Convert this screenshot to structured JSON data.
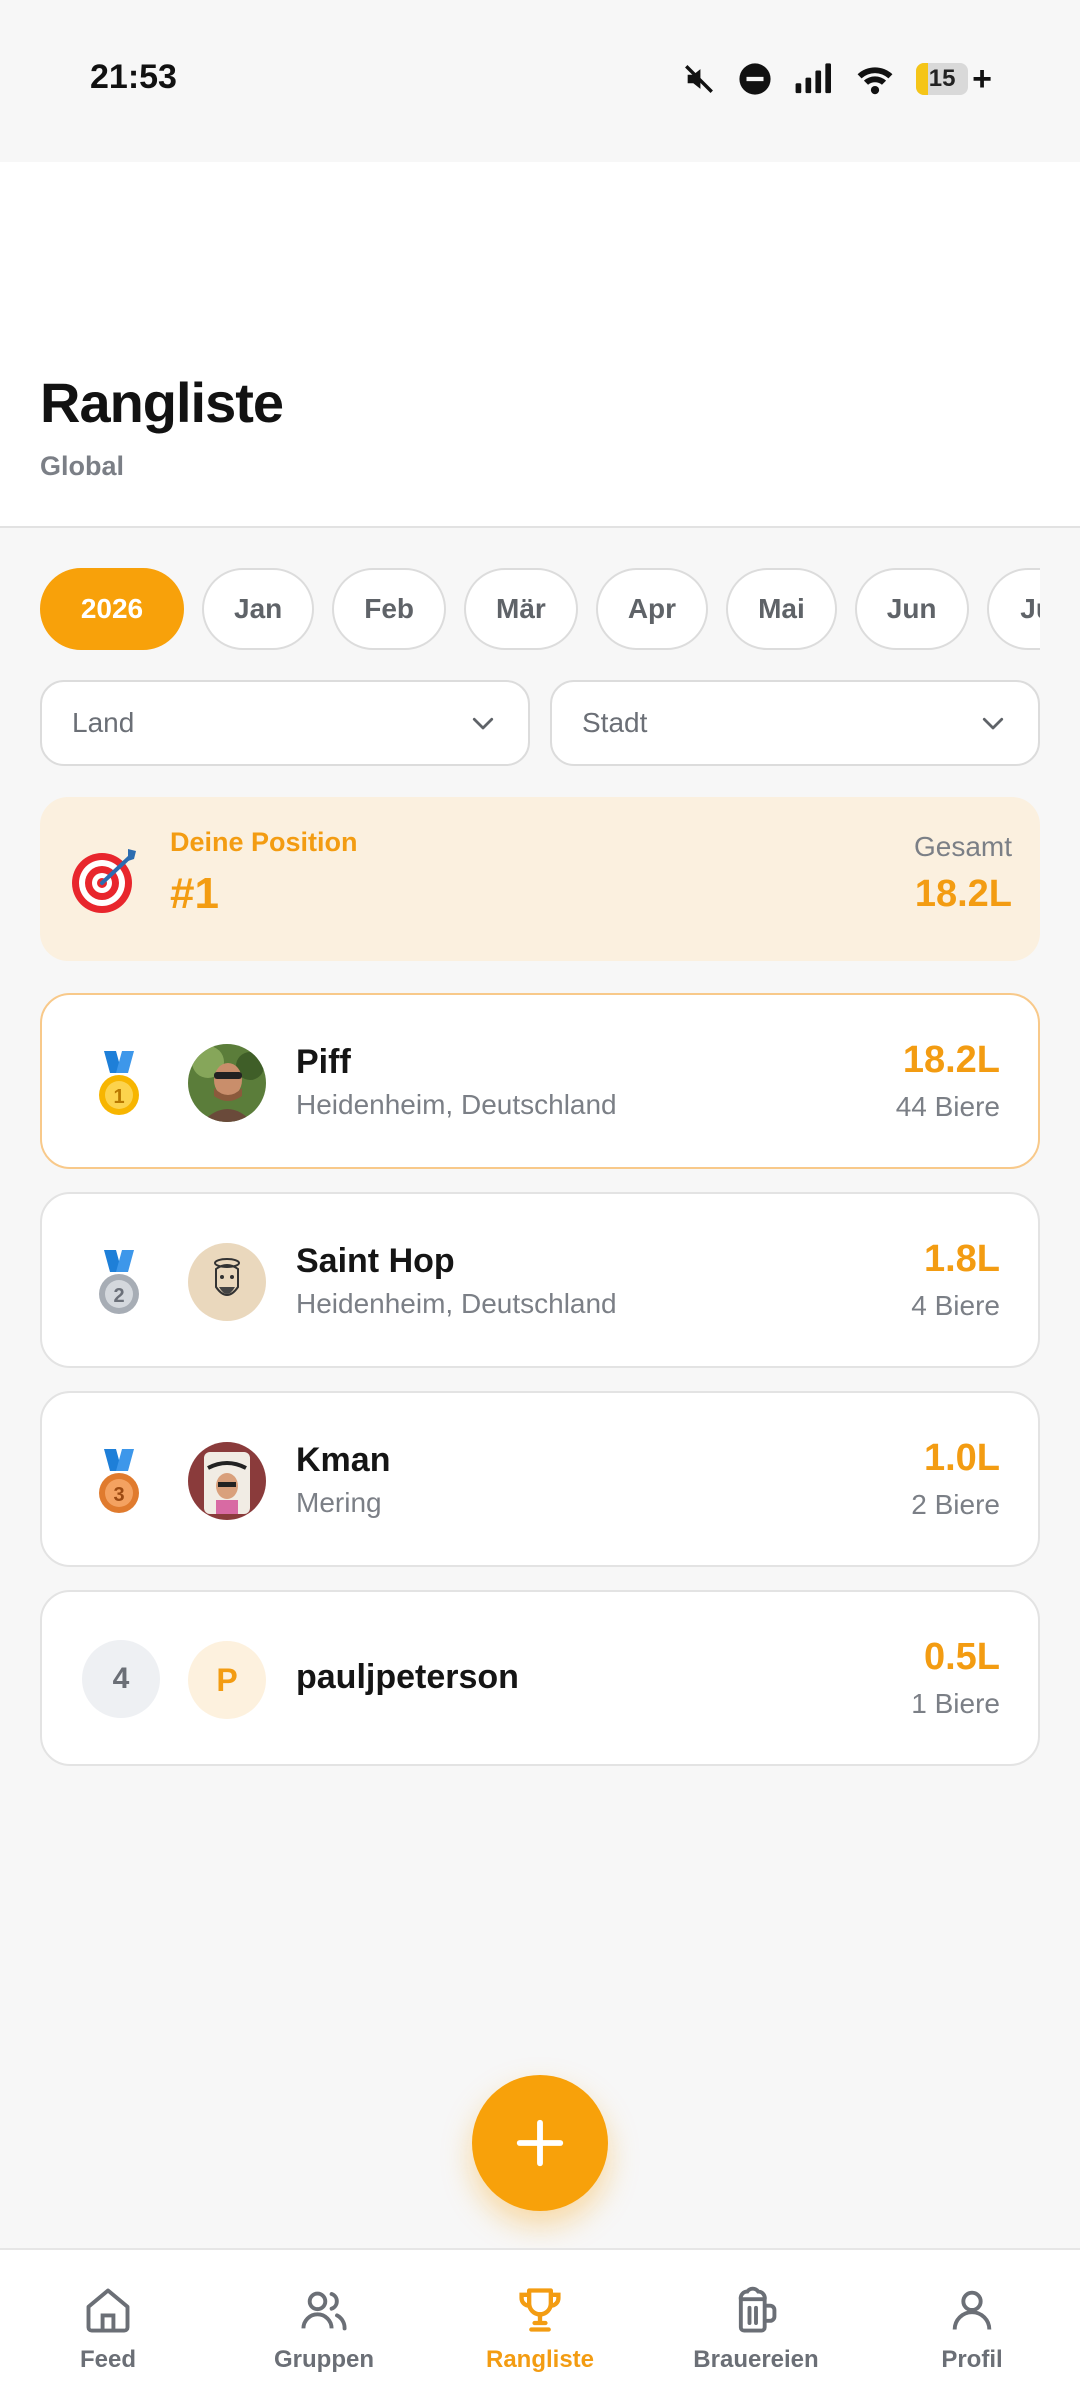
{
  "status_bar": {
    "time": "21:53",
    "battery_level": "15",
    "icons": [
      "mute-icon",
      "dnd-icon",
      "signal-icon",
      "wifi-icon",
      "battery-icon"
    ]
  },
  "header": {
    "title": "Rangliste",
    "subtitle": "Global"
  },
  "period_chips": [
    {
      "label": "2026",
      "active": true
    },
    {
      "label": "Jan"
    },
    {
      "label": "Feb"
    },
    {
      "label": "Mär"
    },
    {
      "label": "Apr"
    },
    {
      "label": "Mai"
    },
    {
      "label": "Jun"
    },
    {
      "label": "Jul"
    }
  ],
  "filters": {
    "country_placeholder": "Land",
    "city_placeholder": "Stadt"
  },
  "my_position": {
    "label": "Deine Position",
    "rank": "#1",
    "total_label": "Gesamt",
    "total_value": "18.2L"
  },
  "leaderboard": [
    {
      "rank": 1,
      "name": "Piff",
      "location": "Heidenheim, Deutschland",
      "amount": "18.2L",
      "beers": "44 Biere"
    },
    {
      "rank": 2,
      "name": "Saint Hop",
      "location": "Heidenheim, Deutschland",
      "amount": "1.8L",
      "beers": "4 Biere"
    },
    {
      "rank": 3,
      "name": "Kman",
      "location": "Mering",
      "amount": "1.0L",
      "beers": "2 Biere"
    },
    {
      "rank": "4",
      "name": "pauljpeterson",
      "avatar_letter": "P",
      "amount": "0.5L",
      "beers": "1 Biere"
    }
  ],
  "nav": [
    {
      "label": "Feed",
      "icon": "home-icon"
    },
    {
      "label": "Gruppen",
      "icon": "users-icon"
    },
    {
      "label": "Rangliste",
      "icon": "trophy-icon",
      "active": true
    },
    {
      "label": "Brauereien",
      "icon": "beer-mug-icon"
    },
    {
      "label": "Profil",
      "icon": "user-icon"
    }
  ],
  "colors": {
    "accent": "#f8a10a",
    "accent_text": "#f39c12",
    "position_bg": "#fbf0df"
  }
}
